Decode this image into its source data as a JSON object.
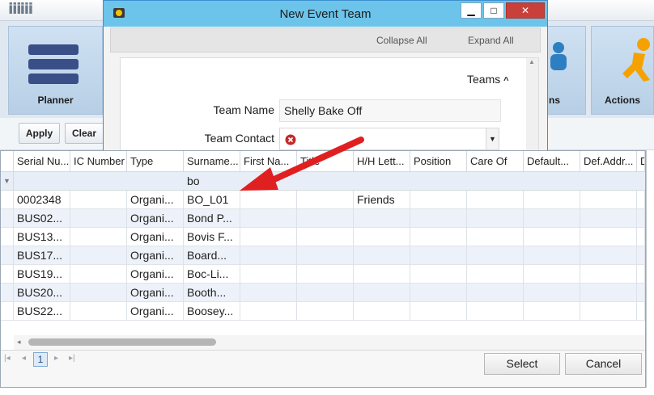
{
  "app": {
    "ribbon_tiles": [
      {
        "label": "Planner"
      },
      {
        "label": "ns"
      },
      {
        "label": "Actions"
      }
    ],
    "filter_buttons": {
      "apply": "Apply",
      "clear": "Clear"
    }
  },
  "dialog": {
    "title": "New Event Team",
    "window_buttons": {
      "minimize": "▁",
      "maximize": "□",
      "close": "✕"
    },
    "toolbar": {
      "collapse_all": "Collapse All",
      "expand_all": "Expand All"
    },
    "section": {
      "label": "Teams",
      "toggle": "^"
    },
    "fields": {
      "team_name": {
        "label": "Team Name",
        "value": "Shelly Bake Off"
      },
      "team_contact": {
        "label": "Team Contact",
        "value": ""
      }
    }
  },
  "grid": {
    "columns": [
      "Serial Nu...",
      "IC Number",
      "Type",
      "Surname...",
      "First Na...",
      "Title",
      "H/H Lett...",
      "Position",
      "Care Of",
      "Default...",
      "Def.Addr...",
      "D"
    ],
    "filter_value": "bo",
    "rows": [
      [
        "0002348",
        "",
        "Organi...",
        "BO_L01",
        "",
        "",
        "Friends",
        "",
        "",
        "",
        "",
        ""
      ],
      [
        "BUS02...",
        "",
        "Organi...",
        "Bond P...",
        "",
        "",
        "",
        "",
        "",
        "",
        "",
        ""
      ],
      [
        "BUS13...",
        "",
        "Organi...",
        "Bovis F...",
        "",
        "",
        "",
        "",
        "",
        "",
        "",
        ""
      ],
      [
        "BUS17...",
        "",
        "Organi...",
        "Board...",
        "",
        "",
        "",
        "",
        "",
        "",
        "",
        ""
      ],
      [
        "BUS19...",
        "",
        "Organi...",
        "Boc-Li...",
        "",
        "",
        "",
        "",
        "",
        "",
        "",
        ""
      ],
      [
        "BUS20...",
        "",
        "Organi...",
        "Booth...",
        "",
        "",
        "",
        "",
        "",
        "",
        "",
        ""
      ],
      [
        "BUS22...",
        "",
        "Organi...",
        "Boosey...",
        "",
        "",
        "",
        "",
        "",
        "",
        "",
        ""
      ]
    ],
    "pager": {
      "first": "|◂",
      "prev": "◂",
      "page": "1",
      "next": "▸",
      "last": "▸|"
    },
    "buttons": {
      "select": "Select",
      "cancel": "Cancel"
    }
  },
  "colors": {
    "titlebar": "#6cc4ea",
    "arrow": "#e02020",
    "error_icon": "#c62828"
  }
}
